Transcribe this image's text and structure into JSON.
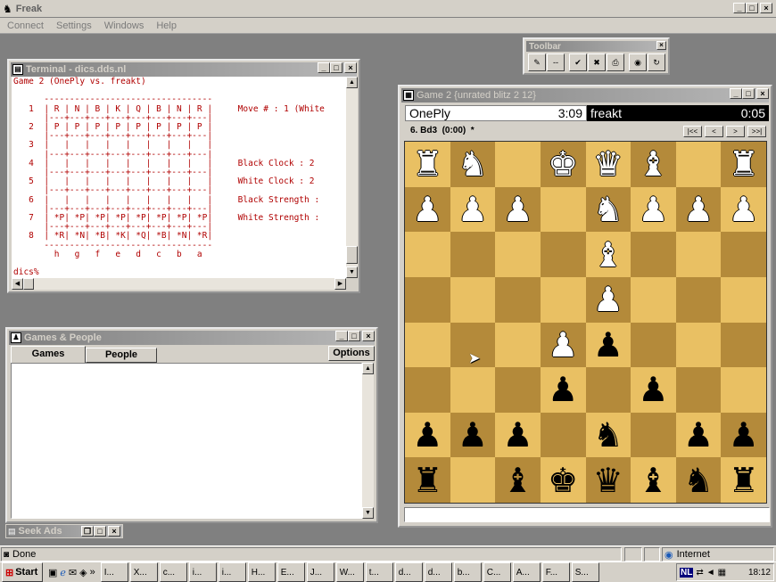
{
  "app": {
    "title": "Freak",
    "menu": [
      "Connect",
      "Settings",
      "Windows",
      "Help"
    ]
  },
  "toolbar": {
    "title": "Toolbar",
    "buttons": [
      "✎",
      "--",
      "✔",
      "✖",
      "⎙",
      "◉",
      "↻"
    ]
  },
  "terminal": {
    "title": "Terminal - dics.dds.nl",
    "lines": [
      "Game 2 (OnePly vs. freakt)",
      "",
      "      ---------------------------------",
      "   1  | R | N | B | K | Q | B | N | R |     Move # : 1 (White",
      "      |---+---+---+---+---+---+---+---|",
      "   2  | P | P | P | P | P | P | P | P |",
      "      |---+---+---+---+---+---+---+---|",
      "   3  |   |   |   |   |   |   |   |   |",
      "      |---+---+---+---+---+---+---+---|",
      "   4  |   |   |   |   |   |   |   |   |     Black Clock : 2",
      "      |---+---+---+---+---+---+---+---|",
      "   5  |   |   |   |   |   |   |   |   |     White Clock : 2",
      "      |---+---+---+---+---+---+---+---|",
      "   6  |   |   |   |   |   |   |   |   |     Black Strength :",
      "      |---+---+---+---+---+---+---+---|",
      "   7  | *P| *P| *P| *P| *P| *P| *P| *P|     White Strength :",
      "      |---+---+---+---+---+---+---+---|",
      "   8  | *R| *N| *B| *K| *Q| *B| *N| *R|",
      "      ---------------------------------",
      "        h   g   f   e   d   c   b   a",
      "",
      "dics%"
    ]
  },
  "games_people": {
    "title": "Games & People",
    "tabs": [
      "Games",
      "People"
    ],
    "options_label": "Options"
  },
  "seek_ads": {
    "title": "Seek Ads"
  },
  "game": {
    "title": "Game 2  {unrated blitz 2 12}",
    "white_player": "OnePly",
    "white_clock": "3:09",
    "black_player": "freakt",
    "black_clock": "0:05",
    "last_move": "6. Bd3  (0:00)  *",
    "nav_buttons": [
      "|<<",
      "<",
      ">",
      ">>|"
    ],
    "board": [
      [
        "wR",
        "wN",
        "",
        "wK",
        "wQ",
        "wB",
        "",
        "wR"
      ],
      [
        "wP",
        "wP",
        "wP",
        "",
        "wN",
        "wP",
        "wP",
        "wP"
      ],
      [
        "",
        "",
        "",
        "",
        "wB",
        "",
        "",
        ""
      ],
      [
        "",
        "",
        "",
        "",
        "wP",
        "",
        "",
        ""
      ],
      [
        "",
        "",
        "",
        "wP",
        "bP",
        "",
        "",
        ""
      ],
      [
        "",
        "",
        "",
        "bP",
        "",
        "bP",
        "",
        ""
      ],
      [
        "bP",
        "bP",
        "bP",
        "",
        "bN",
        "",
        "bP",
        "bP"
      ],
      [
        "bR",
        "",
        "bB",
        "bK",
        "bQ",
        "bB",
        "bN",
        "bR"
      ]
    ],
    "input_value": ""
  },
  "statusbar": {
    "left": "Done",
    "right": "Internet"
  },
  "taskbar": {
    "start": "Start",
    "items": [
      "I...",
      "X...",
      "c...",
      "i...",
      "i...",
      "H...",
      "E...",
      "J...",
      "W...",
      "t...",
      "d...",
      "d...",
      "b...",
      "C...",
      "A...",
      "F...",
      "S..."
    ],
    "lang": "NL",
    "clock": "18:12"
  },
  "colors": {
    "light_square": "#e9c063",
    "dark_square": "#b48a3a",
    "titlebar_active": "#0a246a",
    "desktop": "#808080"
  }
}
